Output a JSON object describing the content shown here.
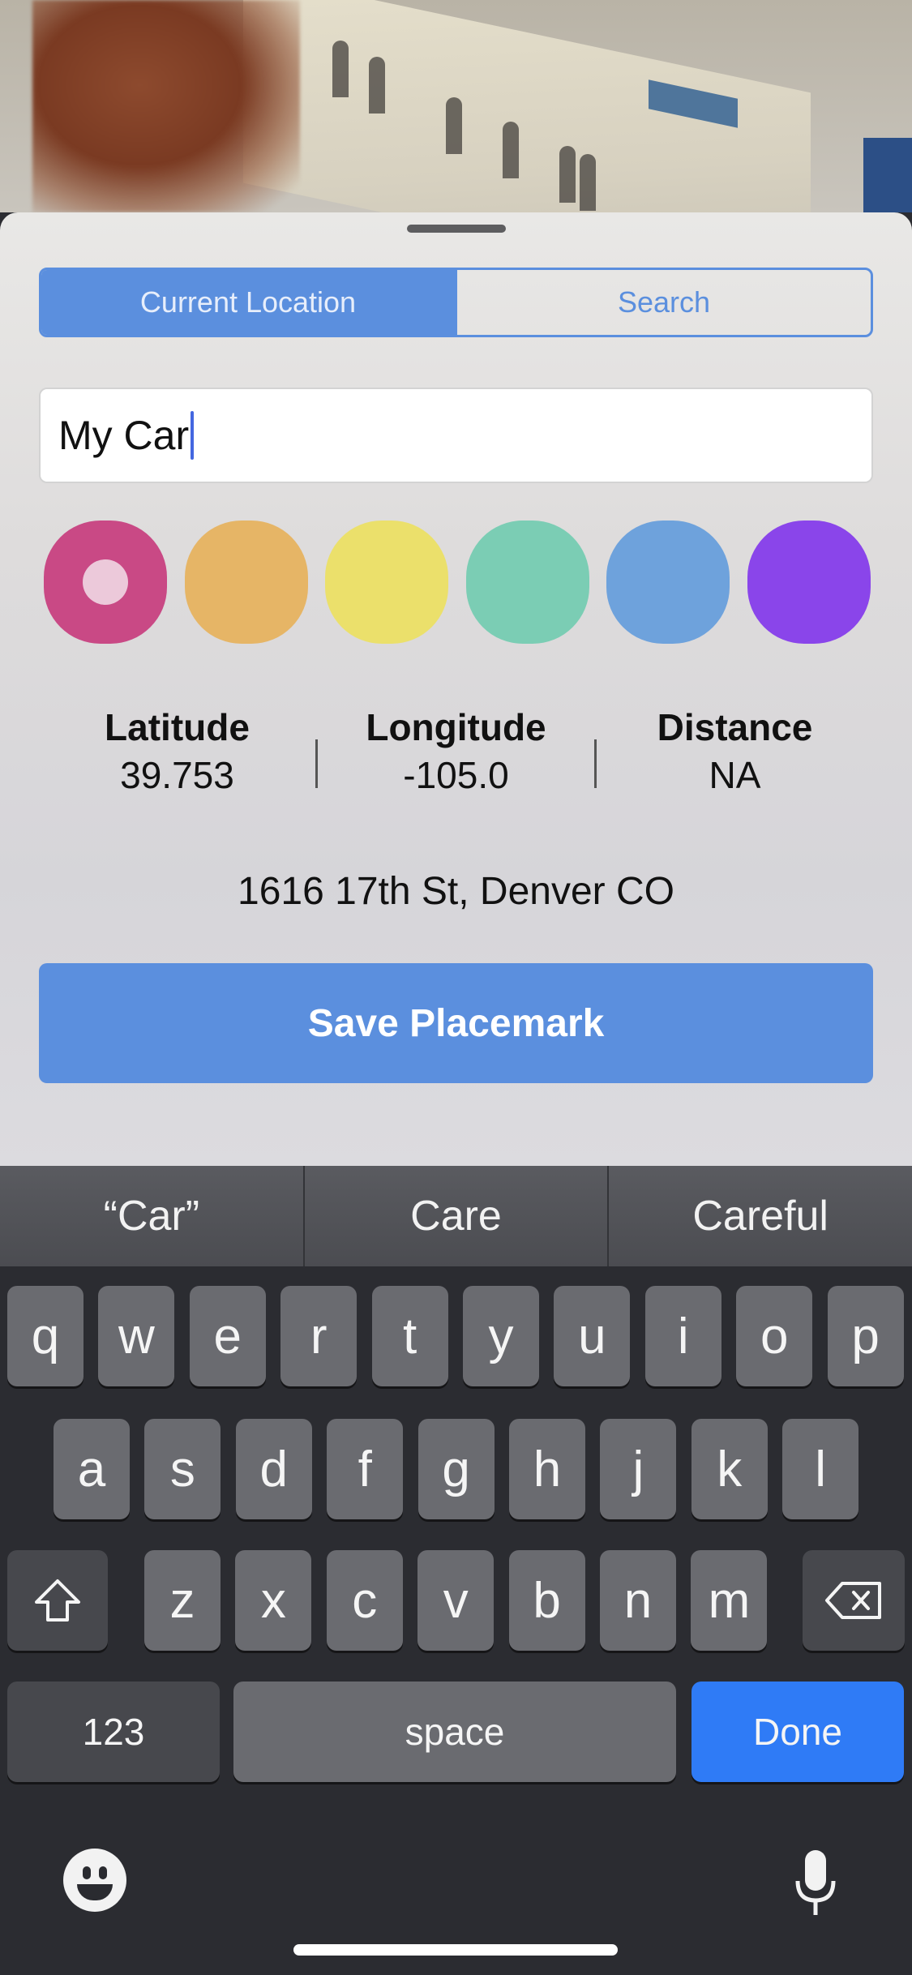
{
  "segmented": {
    "options": [
      "Current Location",
      "Search"
    ],
    "selected": "Current Location"
  },
  "name_field": {
    "value": "My Car"
  },
  "colors": [
    {
      "hex": "#c94985",
      "selected": true
    },
    {
      "hex": "#e6b566",
      "selected": false
    },
    {
      "hex": "#ebe06b",
      "selected": false
    },
    {
      "hex": "#7bcdb4",
      "selected": false
    },
    {
      "hex": "#6ea2dc",
      "selected": false
    },
    {
      "hex": "#8a45ea",
      "selected": false
    }
  ],
  "coords": {
    "latitude_label": "Latitude",
    "latitude_value": "39.753",
    "longitude_label": "Longitude",
    "longitude_value": "-105.0",
    "distance_label": "Distance",
    "distance_value": "NA"
  },
  "address": "1616 17th St, Denver CO",
  "save_button": "Save Placemark",
  "keyboard": {
    "suggestions": [
      "“Car”",
      "Care",
      "Careful"
    ],
    "row1": [
      "q",
      "w",
      "e",
      "r",
      "t",
      "y",
      "u",
      "i",
      "o",
      "p"
    ],
    "row2": [
      "a",
      "s",
      "d",
      "f",
      "g",
      "h",
      "j",
      "k",
      "l"
    ],
    "row3": [
      "z",
      "x",
      "c",
      "v",
      "b",
      "n",
      "m"
    ],
    "numbers_key": "123",
    "space_key": "space",
    "done_key": "Done",
    "shift_icon": "shift-icon",
    "delete_icon": "delete-icon",
    "emoji_icon": "emoji-icon",
    "mic_icon": "microphone-icon"
  },
  "accent_color": "#5b8fde",
  "done_color": "#2f7bf6"
}
